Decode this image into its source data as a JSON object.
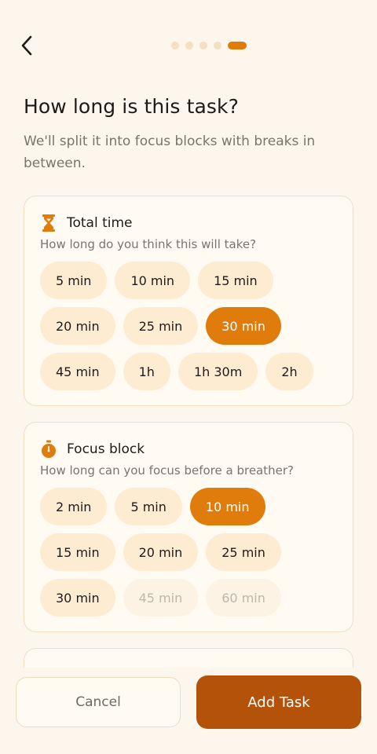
{
  "header": {
    "back_icon": "chevron-left-icon",
    "steps_total": 5,
    "steps_current": 5
  },
  "title": "How long is this task?",
  "subtitle": "We'll split it into focus blocks with breaks in between.",
  "total_time": {
    "icon": "hourglass-icon",
    "title": "Total time",
    "subtitle": "How long do you think this will take?",
    "options": [
      "5 min",
      "10 min",
      "15 min",
      "20 min",
      "25 min",
      "30 min",
      "45 min",
      "1h",
      "1h 30m",
      "2h"
    ],
    "selected": "30 min"
  },
  "focus_block": {
    "icon": "stopwatch-icon",
    "title": "Focus block",
    "subtitle": "How long can you focus before a breather?",
    "options": [
      "2 min",
      "5 min",
      "10 min",
      "15 min",
      "20 min",
      "25 min",
      "30 min",
      "45 min",
      "60 min"
    ],
    "selected": "10 min",
    "disabled": [
      "45 min",
      "60 min"
    ]
  },
  "footer": {
    "cancel_label": "Cancel",
    "add_label": "Add Task"
  },
  "colors": {
    "accent": "#e07c0c",
    "primary_button": "#b5520a",
    "background": "#fdf6ec",
    "chip": "#fdecd1"
  }
}
